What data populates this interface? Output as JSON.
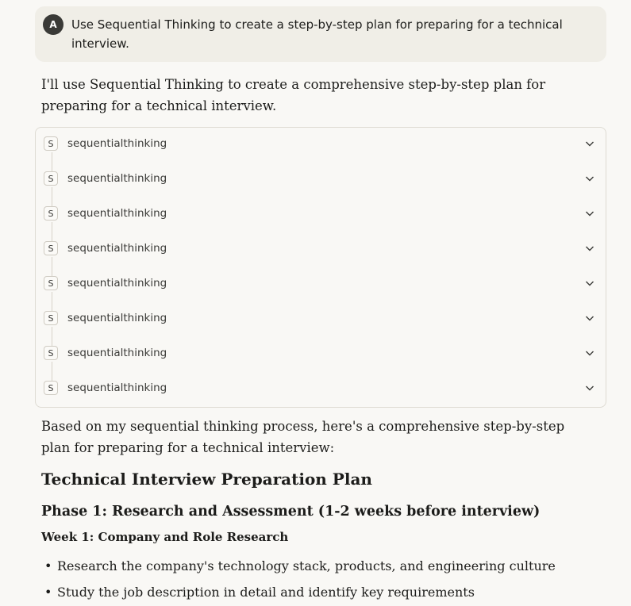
{
  "user_message": {
    "avatar_letter": "A",
    "text": "Use Sequential Thinking to create a step-by-step plan for preparing for a technical interview."
  },
  "assistant": {
    "intro": "I'll use Sequential Thinking to create a comprehensive step-by-step plan for preparing for a technical interview.",
    "tool_calls": [
      {
        "icon_letter": "S",
        "name": "sequentialthinking"
      },
      {
        "icon_letter": "S",
        "name": "sequentialthinking"
      },
      {
        "icon_letter": "S",
        "name": "sequentialthinking"
      },
      {
        "icon_letter": "S",
        "name": "sequentialthinking"
      },
      {
        "icon_letter": "S",
        "name": "sequentialthinking"
      },
      {
        "icon_letter": "S",
        "name": "sequentialthinking"
      },
      {
        "icon_letter": "S",
        "name": "sequentialthinking"
      },
      {
        "icon_letter": "S",
        "name": "sequentialthinking"
      }
    ],
    "summary": "Based on my sequential thinking process, here's a comprehensive step-by-step plan for preparing for a technical interview:",
    "heading": "Technical Interview Preparation Plan",
    "phase1": "Phase 1: Research and Assessment (1-2 weeks before interview)",
    "week1": "Week 1: Company and Role Research",
    "bullets": [
      "Research the company's technology stack, products, and engineering culture",
      "Study the job description in detail and identify key requirements"
    ]
  },
  "icons": {
    "expand": "chevron-down-icon",
    "tool": "s-badge-icon"
  }
}
